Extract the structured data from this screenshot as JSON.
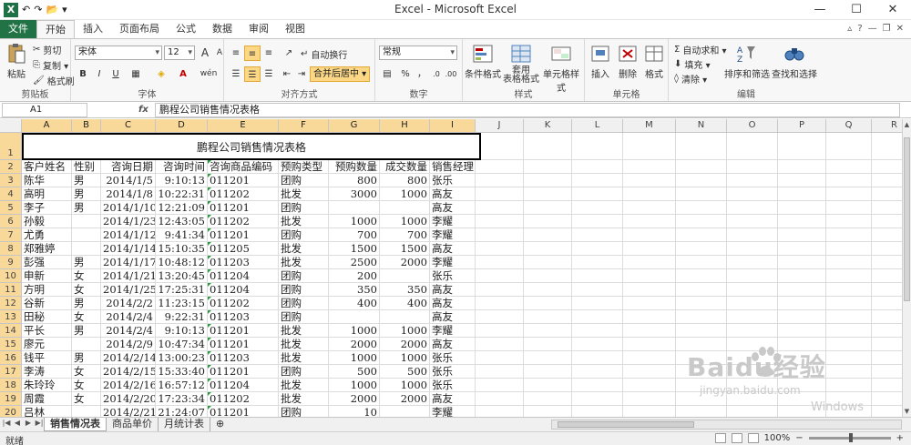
{
  "window": {
    "title": "Excel - Microsoft Excel",
    "qat": {
      "undo": "↶",
      "redo": "↷",
      "folder": "📂",
      "more": "▾"
    },
    "controls": {
      "minimize": "—",
      "maximize": "☐",
      "close": "✕"
    }
  },
  "tabs": [
    {
      "label": "文件",
      "kind": "file"
    },
    {
      "label": "开始",
      "kind": "active"
    },
    {
      "label": "插入",
      "kind": ""
    },
    {
      "label": "页面布局",
      "kind": ""
    },
    {
      "label": "公式",
      "kind": ""
    },
    {
      "label": "数据",
      "kind": ""
    },
    {
      "label": "审阅",
      "kind": ""
    },
    {
      "label": "视图",
      "kind": ""
    }
  ],
  "ribbon": {
    "clipboard": {
      "paste": "粘贴",
      "cut": "剪切",
      "copy": "复制 ▾",
      "format_painter": "格式刷",
      "label": "剪贴板"
    },
    "font": {
      "name": "宋体",
      "size": "12",
      "bold": "B",
      "italic": "I",
      "underline": "U",
      "grow": "A",
      "shrink": "A",
      "wen": "wén",
      "label": "字体"
    },
    "alignment": {
      "wrap": "自动换行",
      "merge": "合并后居中 ▾",
      "label": "对齐方式"
    },
    "number": {
      "format": "常规",
      "percent": "%",
      "comma": "，",
      "label": "数字"
    },
    "styles": {
      "conditional": "条件格式",
      "table": "套用\n表格格式",
      "cell_styles": "单元格样式",
      "label": "样式"
    },
    "cells": {
      "insert": "插入",
      "delete": "删除",
      "format": "格式",
      "label": "单元格"
    },
    "editing": {
      "autosum": "自动求和 ▾",
      "fill": "填充 ▾",
      "clear": "清除 ▾",
      "sort": "排序和筛选",
      "find": "查找和选择",
      "label": "编辑"
    }
  },
  "formula_bar": {
    "name_box": "A1",
    "fx": "fx",
    "content": "鹏程公司销售情况表格"
  },
  "columns": [
    "A",
    "B",
    "C",
    "D",
    "E",
    "F",
    "G",
    "H",
    "I",
    "J",
    "K",
    "L",
    "M",
    "N",
    "O",
    "P",
    "Q",
    "R"
  ],
  "sheet": {
    "title": "鹏程公司销售情况表格",
    "headers": [
      "客户姓名",
      "性别",
      "咨询日期",
      "咨询时间",
      "咨询商品编码",
      "预购类型",
      "预购数量",
      "成交数量",
      "销售经理"
    ],
    "rows": [
      [
        "陈华",
        "男",
        "2014/1/5",
        "9:10:13",
        "011201",
        "团购",
        "800",
        "800",
        "张乐"
      ],
      [
        "高明",
        "男",
        "2014/1/8",
        "10:22:31",
        "011202",
        "批发",
        "3000",
        "1000",
        "高友"
      ],
      [
        "李子",
        "男",
        "2014/1/10",
        "12:21:09",
        "011201",
        "团购",
        "",
        "",
        "高友"
      ],
      [
        "孙毅",
        "",
        "2014/1/23",
        "12:43:05",
        "011202",
        "批发",
        "1000",
        "1000",
        "李耀"
      ],
      [
        "尤勇",
        "",
        "2014/1/12",
        "9:41:34",
        "011201",
        "团购",
        "700",
        "700",
        "李耀"
      ],
      [
        "郑雅婷",
        "",
        "2014/1/14",
        "15:10:35",
        "011205",
        "批发",
        "1500",
        "1500",
        "高友"
      ],
      [
        "彭强",
        "男",
        "2014/1/17",
        "10:48:12",
        "011203",
        "批发",
        "2500",
        "2000",
        "李耀"
      ],
      [
        "申新",
        "女",
        "2014/1/21",
        "13:20:45",
        "011204",
        "团购",
        "200",
        "",
        "张乐"
      ],
      [
        "方明",
        "女",
        "2014/1/25",
        "17:25:31",
        "011204",
        "团购",
        "350",
        "350",
        "高友"
      ],
      [
        "谷新",
        "男",
        "2014/2/2",
        "11:23:15",
        "011202",
        "团购",
        "400",
        "400",
        "高友"
      ],
      [
        "田秘",
        "女",
        "2014/2/4",
        "9:22:31",
        "011203",
        "团购",
        "",
        "",
        "高友"
      ],
      [
        "平长",
        "男",
        "2014/2/4",
        "9:10:13",
        "011201",
        "批发",
        "1000",
        "1000",
        "李耀"
      ],
      [
        "廖元",
        "",
        "2014/2/9",
        "10:47:34",
        "011201",
        "批发",
        "2000",
        "2000",
        "高友"
      ],
      [
        "钱平",
        "男",
        "2014/2/14",
        "13:00:23",
        "011203",
        "批发",
        "1000",
        "1000",
        "张乐"
      ],
      [
        "李涛",
        "女",
        "2014/2/15",
        "15:33:40",
        "011201",
        "团购",
        "500",
        "500",
        "张乐"
      ],
      [
        "朱玲玲",
        "女",
        "2014/2/16",
        "16:57:12",
        "011204",
        "批发",
        "1000",
        "1000",
        "张乐"
      ],
      [
        "周霞",
        "女",
        "2014/2/20",
        "17:23:34",
        "011202",
        "批发",
        "2000",
        "2000",
        "高友"
      ],
      [
        "吕林",
        "",
        "2014/2/21",
        "21:24:07",
        "011201",
        "团购",
        "10",
        "",
        "李耀"
      ]
    ]
  },
  "sheet_tabs": [
    "销售情况表",
    "商品单价",
    "月统计表"
  ],
  "status": {
    "ready": "就绪",
    "zoom": "100%"
  },
  "watermark": {
    "brand": "Baidu经验",
    "url": "jingyan.baidu.com",
    "os": "Windows"
  }
}
